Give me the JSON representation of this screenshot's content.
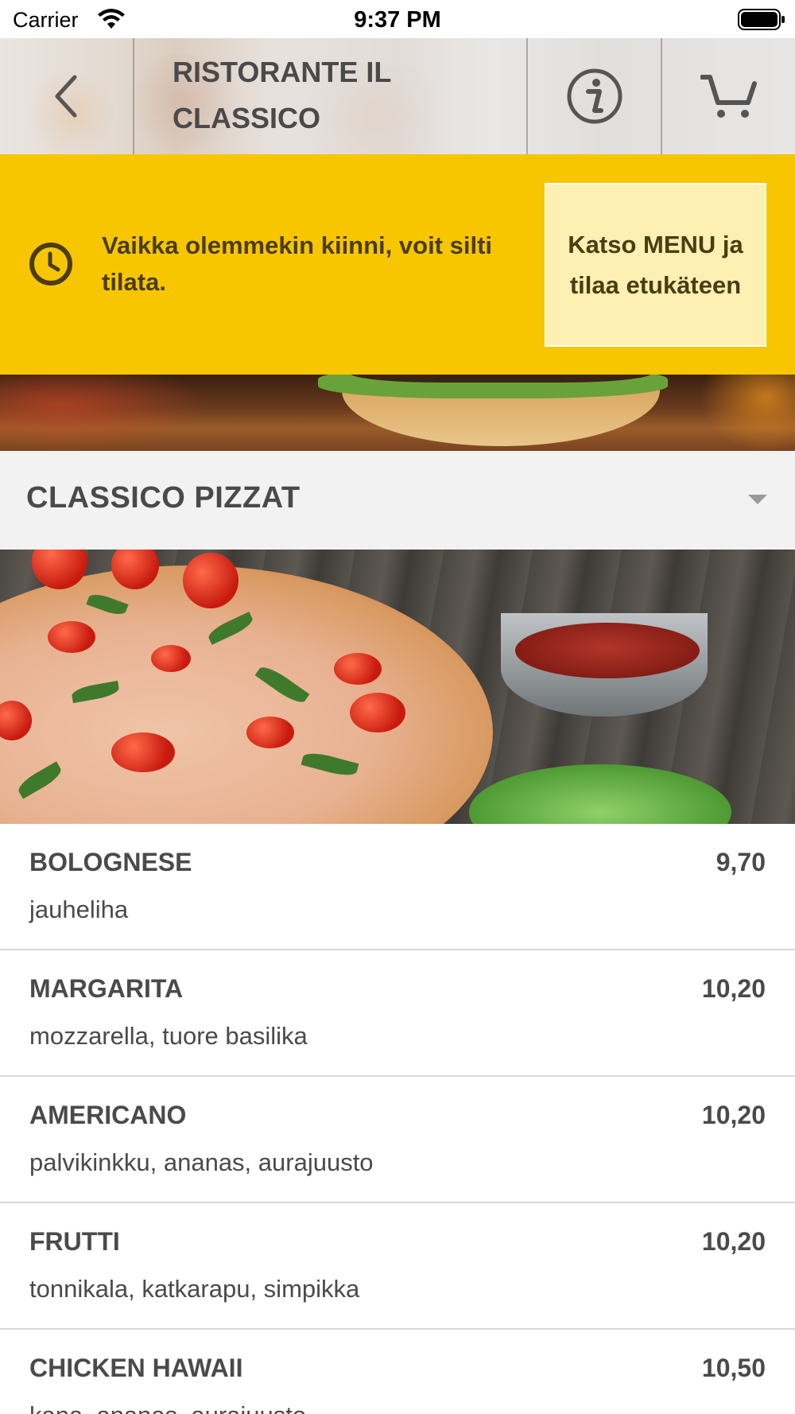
{
  "status_bar": {
    "carrier": "Carrier",
    "time": "9:37 PM"
  },
  "header": {
    "title": "RISTORANTE IL CLASSICO",
    "back_icon": "chevron-left-icon",
    "info_icon": "info-icon",
    "cart_icon": "cart-icon"
  },
  "notice": {
    "icon": "clock-icon",
    "text": "Vaikka olemmekin kiinni, voit silti tilata.",
    "button_label": "Katso MENU ja tilaa etukäteen",
    "background_color": "#f7c600",
    "button_color": "#fdf0b2"
  },
  "category": {
    "title": "CLASSICO PIZZAT",
    "toggle_icon": "caret-down-icon"
  },
  "menu_items": [
    {
      "name": "BOLOGNESE",
      "price": "9,70",
      "description": "jauheliha"
    },
    {
      "name": "MARGARITA",
      "price": "10,20",
      "description": "mozzarella, tuore basilika"
    },
    {
      "name": "AMERICANO",
      "price": "10,20",
      "description": "palvikinkku, ananas, aurajuusto"
    },
    {
      "name": "FRUTTI",
      "price": "10,20",
      "description": "tonnikala, katkarapu, simpikka"
    },
    {
      "name": "CHICKEN HAWAII",
      "price": "10,50",
      "description": "kana, ananas, aurajuusto"
    }
  ]
}
